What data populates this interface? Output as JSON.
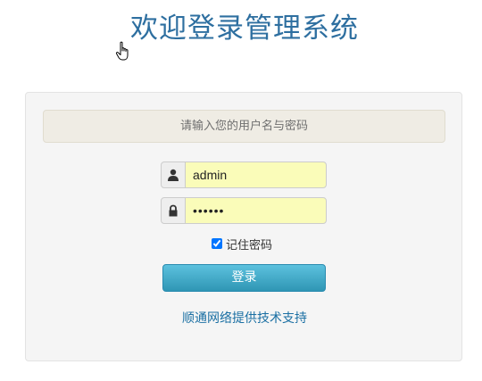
{
  "header": {
    "title": "欢迎登录管理系统"
  },
  "alert": {
    "message": "请输入您的用户名与密码"
  },
  "form": {
    "username_value": "admin",
    "password_value": "••••••",
    "remember_label": "记住密码",
    "remember_checked": true,
    "login_label": "登录"
  },
  "footer": {
    "support_text": "顺通网络提供技术支持"
  },
  "icons": {
    "user": "user-icon",
    "lock": "lock-icon",
    "cursor": "hand-pointer-icon"
  },
  "colors": {
    "title": "#2e6fa0",
    "button": "#3aa7c8",
    "input_bg": "#fafcb9",
    "link": "#1a6fa3"
  }
}
